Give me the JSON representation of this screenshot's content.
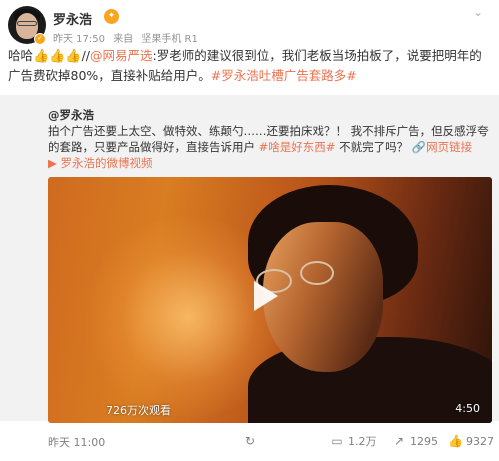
{
  "post": {
    "username": "罗永浩",
    "vip_badge": "✦",
    "meta": {
      "time": "昨天 17:50",
      "source_prefix": "来自",
      "source": "坚果手机 R1"
    },
    "text": {
      "prefix": "哈哈",
      "emoji": "👍👍👍",
      "separator": "//",
      "mention": "@网易严选",
      "body": ":罗老师的建议很到位，我们老板当场拍板了，说要把明年的广告费砍掉80%，直接补贴给用户。",
      "hashtag": "#罗永浩吐槽广告套路多#"
    }
  },
  "repost": {
    "user": "@罗永浩",
    "text_1": "拍个广告还要上太空、做特效、练颠勺……还要拍床戏？！ 我不排斥广告，但反感浮夸的套路，只要产品做得好，直接告诉用户 ",
    "hashtag": "#啥是好东西#",
    "text_2": " 不就完了吗？",
    "link_icon": "🔗",
    "link_text": "网页链接",
    "video_link_icon": "▶",
    "video_link_text": "罗永浩的微博视频"
  },
  "video": {
    "views": "726万次观看",
    "duration": "4:50"
  },
  "footer": {
    "time": "昨天 11:00",
    "repost_count": "",
    "comments": "1.2万",
    "shares": "1295",
    "likes": "9327"
  },
  "icons": {
    "more": "⌄",
    "repost": "↻",
    "comment": "▭",
    "share": "↗",
    "like": "👍"
  },
  "colors": {
    "link": "#eb7350",
    "repost_bg": "#f2f2f2",
    "badge": "#f6a623"
  }
}
